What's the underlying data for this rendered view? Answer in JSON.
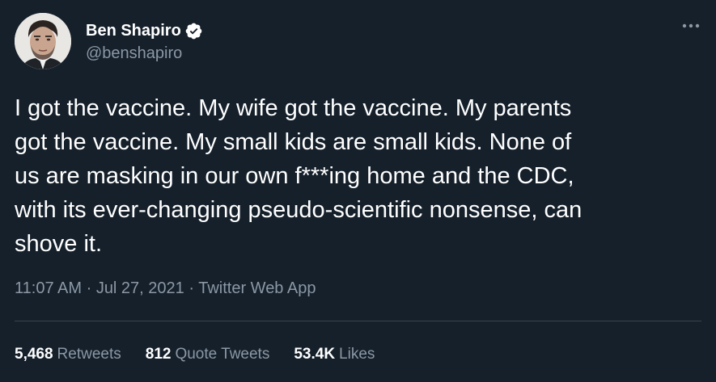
{
  "author": {
    "display_name": "Ben Shapiro",
    "handle": "@benshapiro",
    "verified": true
  },
  "tweet": {
    "text": "I got the vaccine. My wife got the vaccine. My parents\ngot the vaccine. My small kids are small kids. None of\nus are masking in our own f***ing home and the CDC,\nwith its ever-changing pseudo-scientific nonsense, can\nshove it."
  },
  "meta": {
    "time": "11:07 AM",
    "separator1": " · ",
    "date": "Jul 27, 2021",
    "separator2": " · ",
    "source": "Twitter Web App"
  },
  "stats": {
    "retweets_count": "5,468",
    "retweets_label": "Retweets",
    "quotes_count": "812",
    "quotes_label": "Quote Tweets",
    "likes_count": "53.4K",
    "likes_label": "Likes"
  },
  "colors": {
    "background": "#15202b",
    "verified_badge": "#ffffff",
    "secondary_text": "#8b98a5"
  },
  "icons": {
    "verified": "verified-badge-icon",
    "more": "more-options-icon"
  }
}
